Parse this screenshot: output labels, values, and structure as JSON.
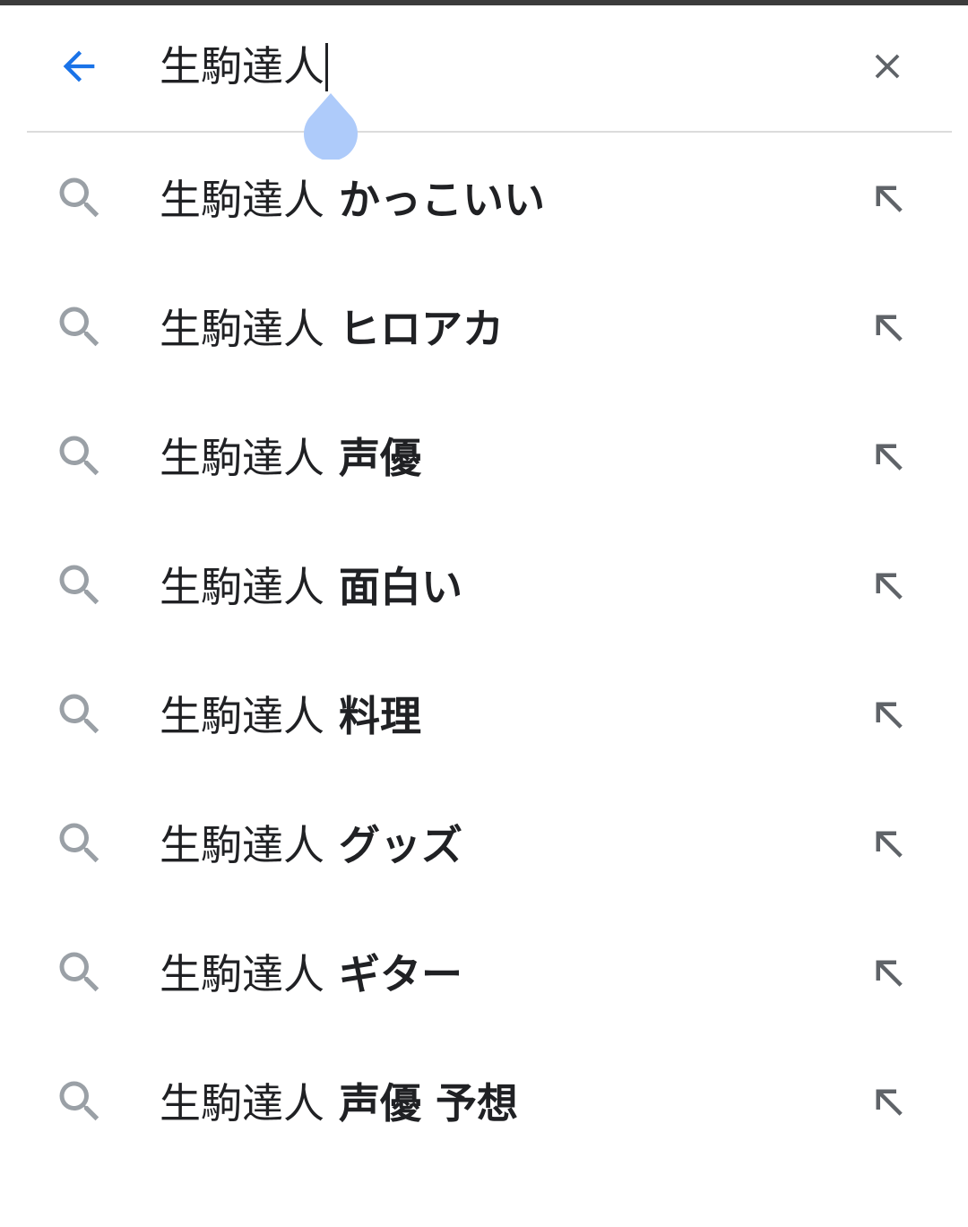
{
  "colors": {
    "accent": "#1a73e8",
    "icon_gray": "#9aa0a6",
    "text": "#202124",
    "handle": "#aecbfa",
    "divider": "#dcdcdc"
  },
  "search": {
    "query": "生駒達人",
    "back_icon": "arrow-back-icon",
    "clear_icon": "close-icon"
  },
  "suggestions": [
    {
      "base": "生駒達人",
      "suffix": " かっこいい",
      "icon": "search-icon",
      "action_icon": "arrow-up-left-icon"
    },
    {
      "base": "生駒達人",
      "suffix": " ヒロアカ",
      "icon": "search-icon",
      "action_icon": "arrow-up-left-icon"
    },
    {
      "base": "生駒達人",
      "suffix": " 声優",
      "icon": "search-icon",
      "action_icon": "arrow-up-left-icon"
    },
    {
      "base": "生駒達人",
      "suffix": " 面白い",
      "icon": "search-icon",
      "action_icon": "arrow-up-left-icon"
    },
    {
      "base": "生駒達人",
      "suffix": " 料理",
      "icon": "search-icon",
      "action_icon": "arrow-up-left-icon"
    },
    {
      "base": "生駒達人",
      "suffix": " グッズ",
      "icon": "search-icon",
      "action_icon": "arrow-up-left-icon"
    },
    {
      "base": "生駒達人",
      "suffix": " ギター",
      "icon": "search-icon",
      "action_icon": "arrow-up-left-icon"
    },
    {
      "base": "生駒達人",
      "suffix": " 声優 予想",
      "icon": "search-icon",
      "action_icon": "arrow-up-left-icon"
    }
  ]
}
